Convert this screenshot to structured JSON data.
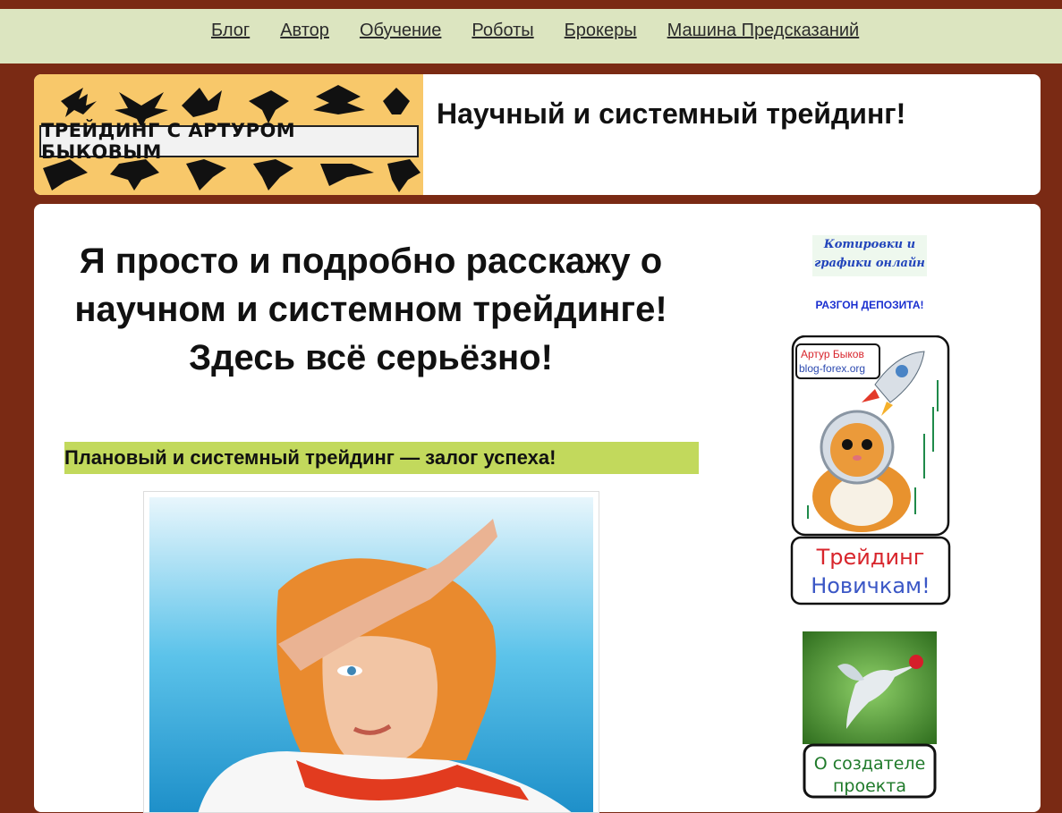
{
  "nav": {
    "items": [
      "Блог",
      "Автор",
      "Обучение",
      "Роботы",
      "Брокеры",
      "Машина Предсказаний"
    ]
  },
  "header": {
    "logo_text": "ТРЕЙДИНГ С АРТУРОМ БЫКОВЫМ",
    "site_title": "Научный и системный трейдинг!"
  },
  "main": {
    "headline": "Я просто и подробно расскажу о научном и системном трейдинге! Здесь всё серьёзно!",
    "banner_text": "Плановый и системный трейдинг — залог успеха!"
  },
  "sidebar": {
    "quotes_link_line1": "Котировки и",
    "quotes_link_line2": "графики онлайн",
    "razgon_link": "РАЗГОН ДЕПОЗИТА!",
    "novice_banner": {
      "author": "Артур Быков",
      "site": "blog-forex.org",
      "line1": "Трейдинг",
      "line2": "Новичкам!"
    },
    "creator_banner": {
      "line1": "О создателе",
      "line2": "проекта"
    }
  },
  "colors": {
    "background": "#7a2a14",
    "nav_bg": "#dce5c0",
    "banner_green": "#c2d95c",
    "logo_bg": "#f8c86a",
    "link_blue": "#1a2fd0"
  }
}
